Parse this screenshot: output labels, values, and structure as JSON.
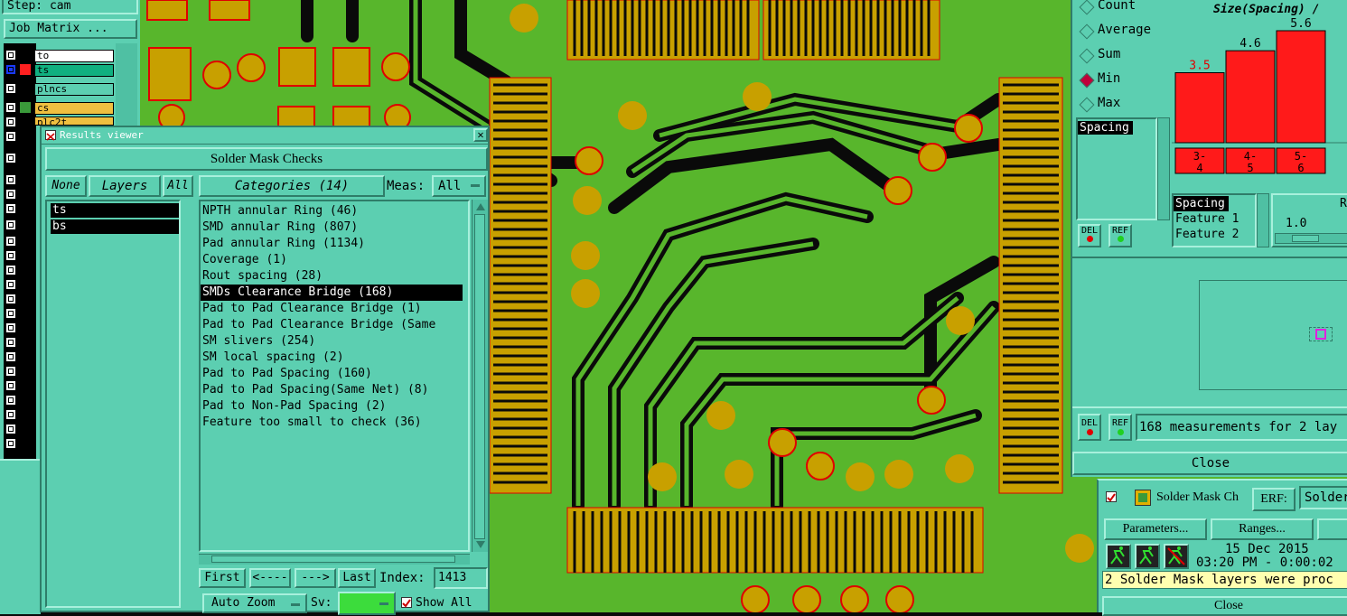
{
  "window_left": {
    "step_label": "Step: cam",
    "job_matrix_button": "Job Matrix ...",
    "layers": [
      {
        "name": "to",
        "color": "#ffffff"
      },
      {
        "name": "ts",
        "color": "#10b080"
      },
      {
        "name": "plncs",
        "color": "#5ccfb1"
      },
      {
        "name": "cs",
        "color": "#f0c040"
      },
      {
        "name": "plc2t",
        "color": "#f0c040"
      }
    ]
  },
  "results_viewer": {
    "title": "Results viewer",
    "header": "Solder Mask Checks",
    "layers_panel": {
      "none_label": "None",
      "layers_label": "Layers",
      "all_label": "All",
      "items": [
        "ts",
        "bs"
      ]
    },
    "categories_label": "Categories (14)",
    "meas_label": "Meas:",
    "meas_value": "All",
    "categories": [
      "NPTH annular Ring (46)",
      "SMD annular Ring (807)",
      "Pad annular Ring (1134)",
      "Coverage (1)",
      "Rout spacing (28)",
      "SMDs Clearance Bridge (168)",
      "Pad to Pad Clearance Bridge (1)",
      "Pad to Pad Clearance Bridge (Same",
      "SM slivers (254)",
      "SM local spacing (2)",
      "Pad to Pad Spacing (160)",
      "Pad to Pad Spacing(Same Net) (8)",
      "Pad to Non-Pad Spacing (2)",
      "Feature too small to check (36)"
    ],
    "selected_category_index": 5,
    "nav": {
      "first": "First",
      "prev": "<----",
      "next": "--->",
      "last": "Last",
      "index_label": "Index:",
      "index_value": "1413"
    },
    "auto_zoom": "Auto Zoom",
    "sv_label": "Sv:",
    "show_all": "Show All"
  },
  "stats_panel": {
    "radio_options": [
      "Count",
      "Average",
      "Sum",
      "Min",
      "Max"
    ],
    "selected_radio": "Min",
    "attribute_list": [
      "Spacing"
    ],
    "sort_list": [
      "Spacing",
      "Feature 1",
      "Feature 2"
    ],
    "slider_label": "Re",
    "slider_value": "1.0",
    "measurements_text": "168 measurements for 2 lay",
    "close_label": "Close",
    "del_label": "DEL",
    "ref_label": "REF"
  },
  "chart_data": {
    "type": "bar",
    "title": "Size(Spacing) /",
    "categories": [
      "3-4",
      "4-5",
      "5-6"
    ],
    "values": [
      3.5,
      4.6,
      5.6
    ],
    "ylim": [
      0,
      5.6
    ],
    "bar_color": "#ff1a1a",
    "label_colors": [
      "#e00000",
      "#000000",
      "#000000"
    ]
  },
  "solder_mask_window": {
    "title": "Solder Mask Ch",
    "erf_label": "ERF:",
    "erf_value": "Solder",
    "parameters_button": "Parameters...",
    "ranges_button": "Ranges...",
    "date": "15 Dec 2015",
    "time": "03:20 PM - 0:00:02",
    "status": "2 Solder Mask layers were proc",
    "close_label": "Close"
  },
  "colors": {
    "panel": "#5ccfb1",
    "board_green": "#5cb82e",
    "pad_gold": "#c8a000",
    "outline_red": "#e00000"
  }
}
